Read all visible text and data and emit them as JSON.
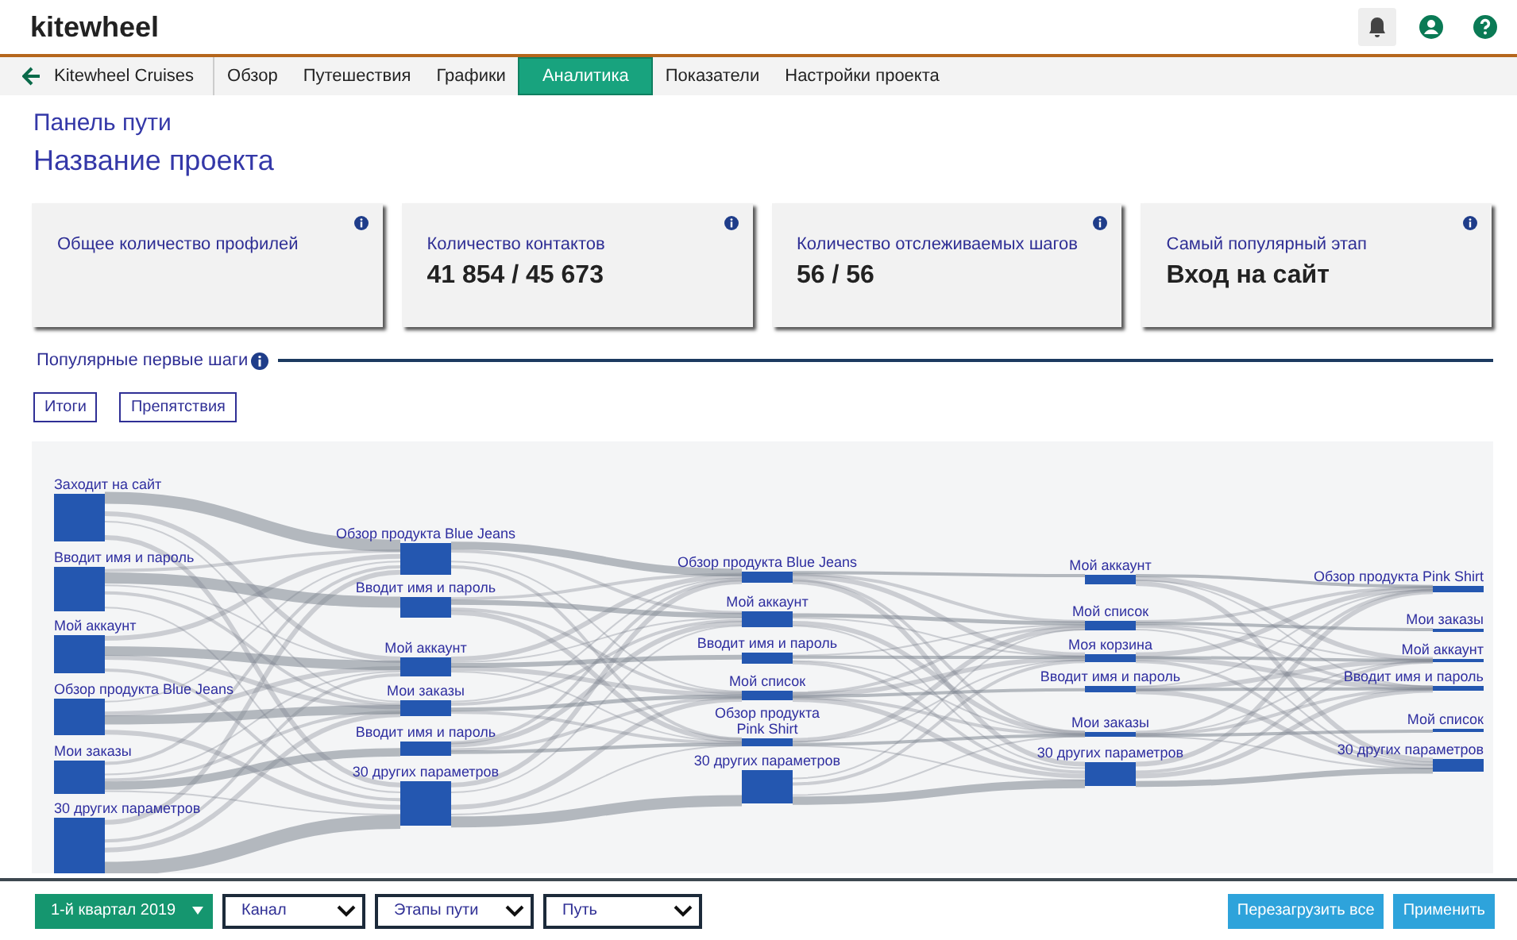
{
  "header": {
    "logo": "kitewheel"
  },
  "nav": {
    "back_label": "Kitewheel Cruises",
    "tabs": [
      {
        "label": "Обзор",
        "selected": false
      },
      {
        "label": "Путешествия",
        "selected": false
      },
      {
        "label": "Графики",
        "selected": false
      },
      {
        "label": "Аналитика",
        "selected": true
      },
      {
        "label": "Показатели",
        "selected": false
      },
      {
        "label": "Настройки проекта",
        "selected": false
      }
    ]
  },
  "breadcrumb": "Панель пути",
  "title": "Название проекта",
  "cards": [
    {
      "title": "Общее количество профилей"
    },
    {
      "title": "Количество контактов",
      "value": "41 854 / 45 673"
    },
    {
      "title": "Количество отслеживаемых шагов",
      "value": "56 / 56"
    },
    {
      "title": "Самый популярный этап",
      "value": "Вход на сайт"
    }
  ],
  "section": {
    "title": "Популярные первые шаги"
  },
  "filters": [
    "Итоги",
    "Препятствия"
  ],
  "sankey": {
    "columns": [
      {
        "nodes": [
          {
            "label": "Заходит на сайт"
          },
          {
            "label": "Вводит имя и пароль"
          },
          {
            "label": "Мой аккаунт"
          },
          {
            "label": "Обзор продукта Blue Jeans"
          },
          {
            "label": "Мои заказы"
          },
          {
            "label": "30 других параметров"
          }
        ]
      },
      {
        "nodes": [
          {
            "label": "Обзор продукта Blue Jeans"
          },
          {
            "label": "Вводит имя и пароль"
          },
          {
            "label": "Мой аккаунт"
          },
          {
            "label": "Мои заказы"
          },
          {
            "label": "Вводит имя и пароль"
          },
          {
            "label": "30 других параметров"
          }
        ]
      },
      {
        "nodes": [
          {
            "label": "Обзор продукта Blue Jeans"
          },
          {
            "label": "Мой аккаунт"
          },
          {
            "label": "Вводит имя и пароль"
          },
          {
            "label": "Мой список"
          },
          {
            "label": "Обзор продукта\nPink Shirt"
          },
          {
            "label": "30 других параметров"
          }
        ]
      },
      {
        "nodes": [
          {
            "label": "Мой аккаунт"
          },
          {
            "label": "Мой список"
          },
          {
            "label": "Моя корзина"
          },
          {
            "label": "Вводит имя и пароль"
          },
          {
            "label": "Мои заказы"
          },
          {
            "label": "30 других параметров"
          }
        ]
      },
      {
        "nodes": [
          {
            "label": "Обзор продукта Pink Shirt"
          },
          {
            "label": "Мои заказы"
          },
          {
            "label": "Мой аккаунт"
          },
          {
            "label": "Вводит имя и пароль"
          },
          {
            "label": "Мой список"
          },
          {
            "label": "30 других параметров"
          }
        ]
      }
    ]
  },
  "footer": {
    "period": "1-й квартал 2019",
    "dropdowns": [
      "Канал",
      "Этапы пути",
      "Путь"
    ],
    "buttons": [
      "Перезагрузить все",
      "Применить"
    ]
  }
}
